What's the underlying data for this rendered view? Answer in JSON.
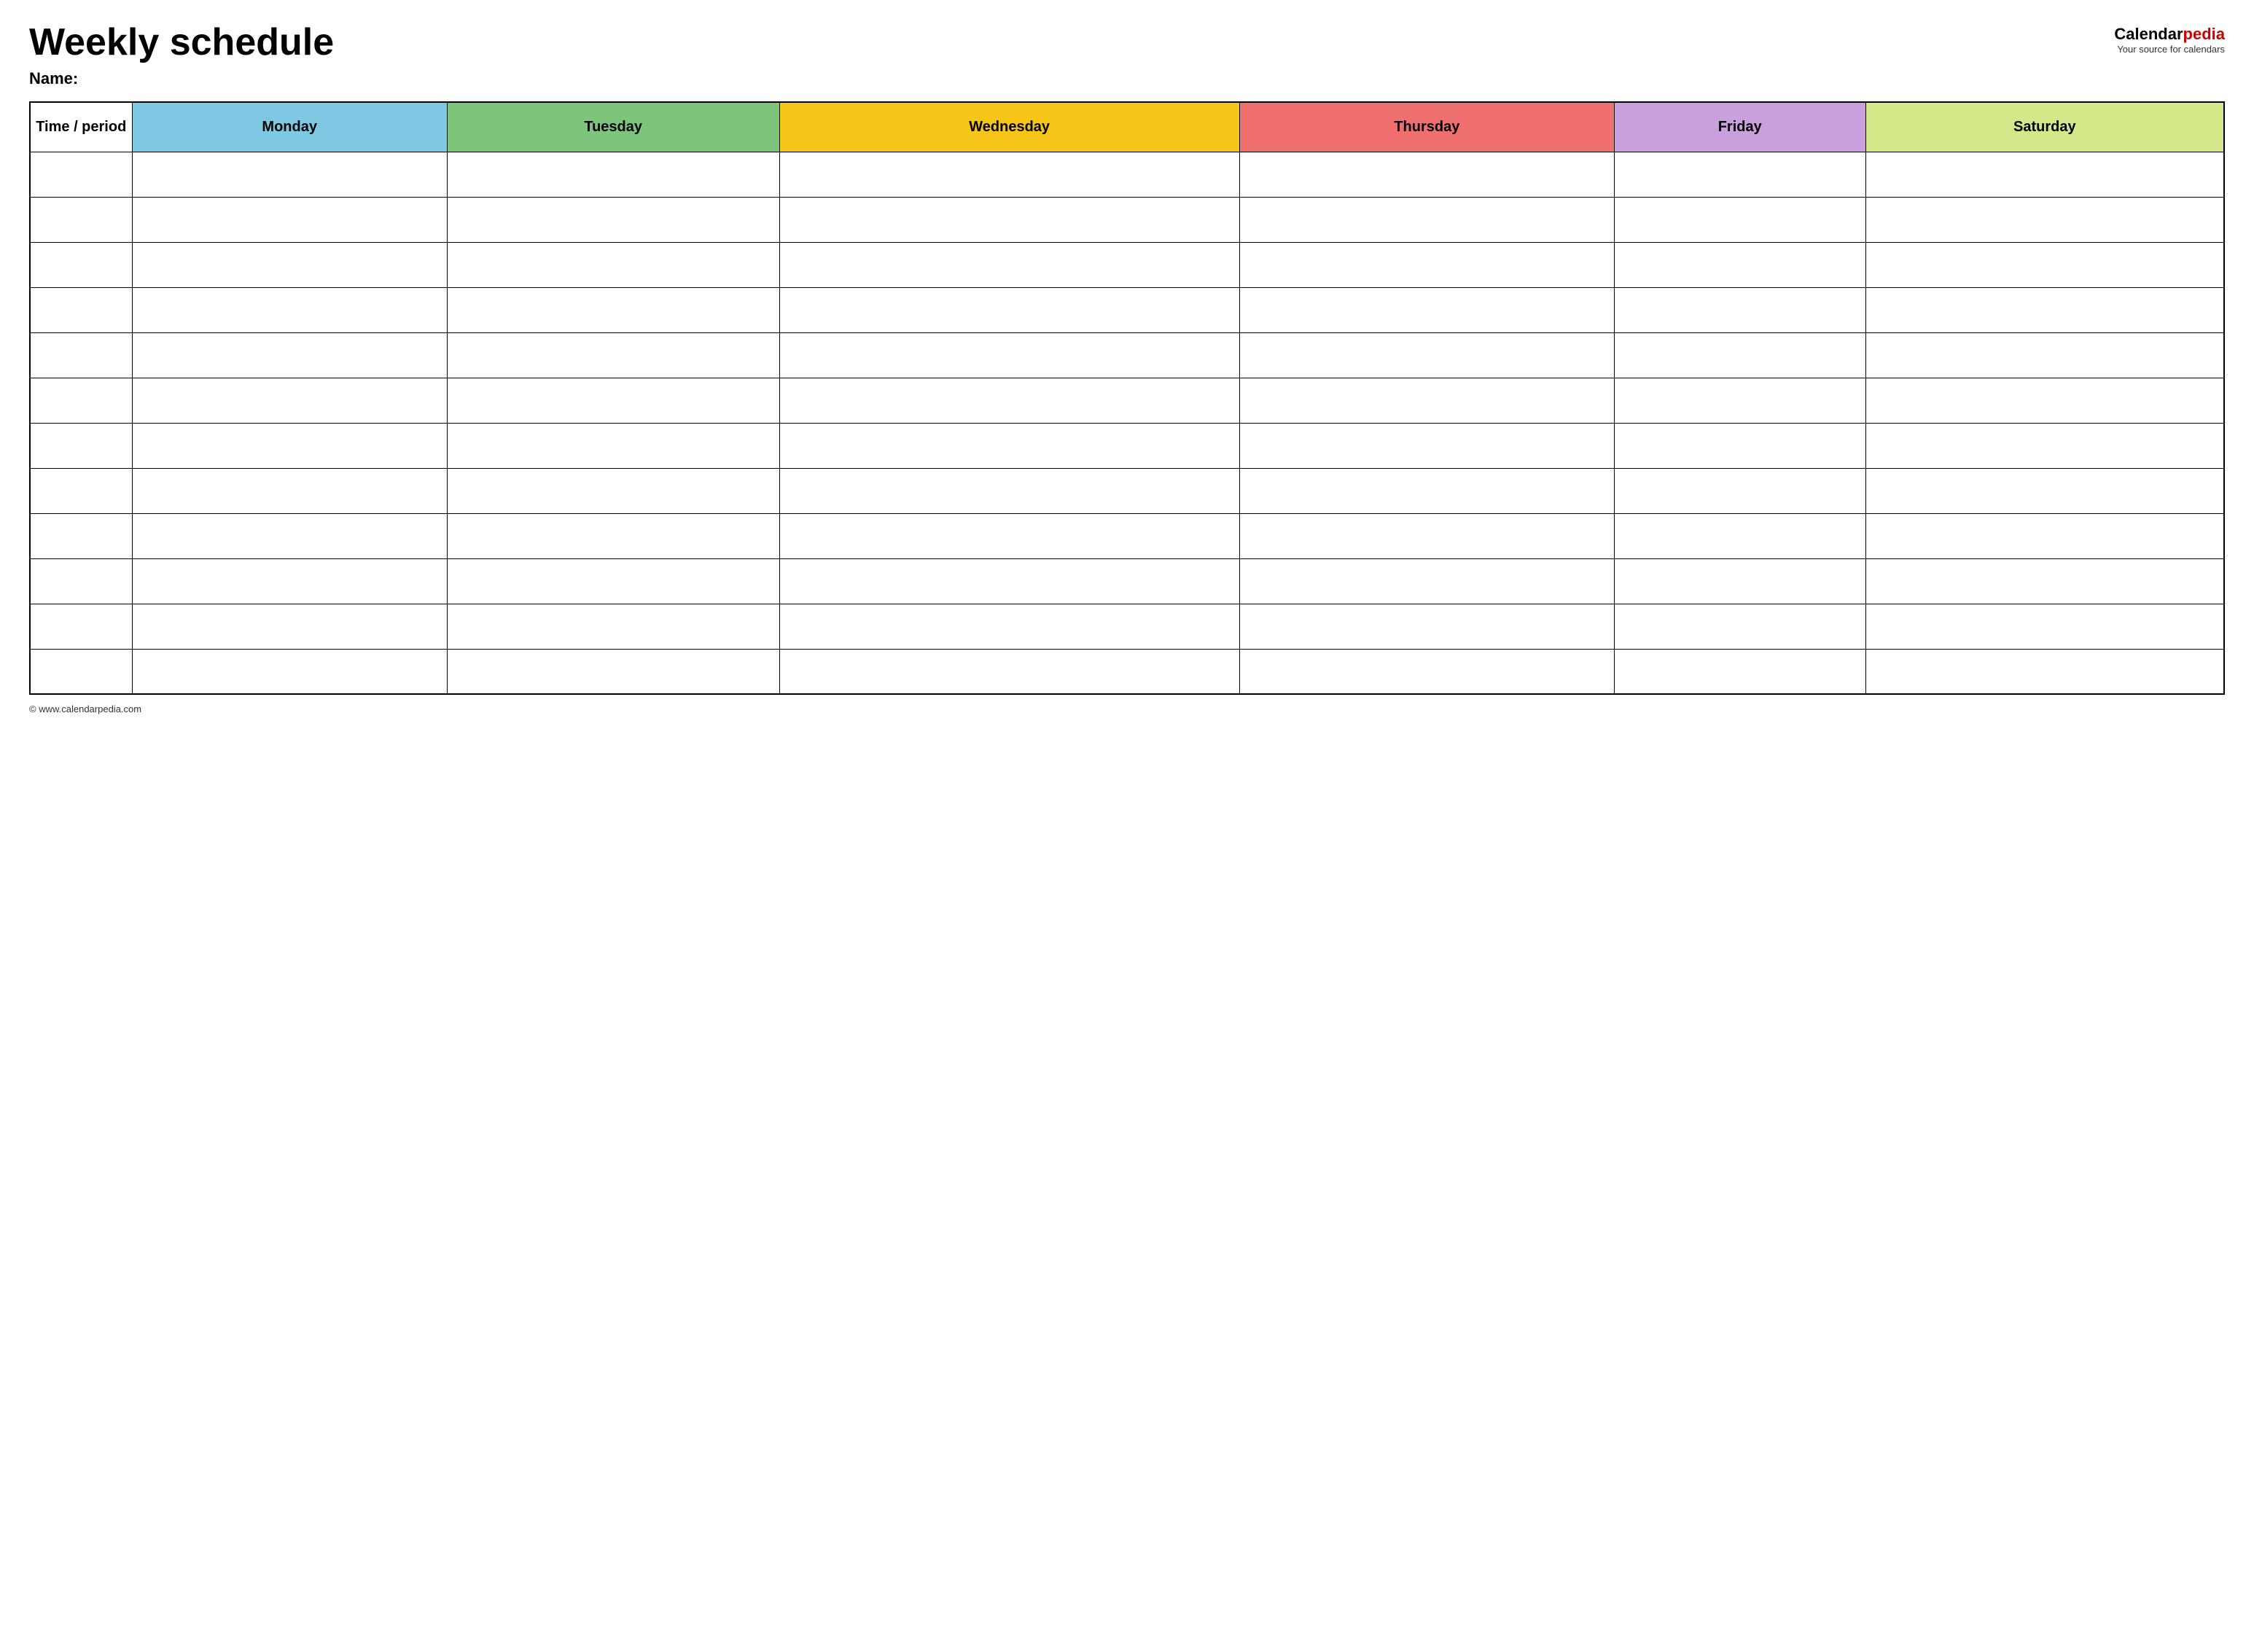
{
  "header": {
    "title": "Weekly schedule",
    "name_label": "Name:",
    "logo_part1": "Calendar",
    "logo_part2": "pedia",
    "logo_tagline": "Your source for calendars",
    "logo_url_text": "www.calendarpedia.com"
  },
  "table": {
    "columns": [
      {
        "key": "time",
        "label": "Time / period",
        "class": "th-time"
      },
      {
        "key": "monday",
        "label": "Monday",
        "class": "th-monday"
      },
      {
        "key": "tuesday",
        "label": "Tuesday",
        "class": "th-tuesday"
      },
      {
        "key": "wednesday",
        "label": "Wednesday",
        "class": "th-wednesday"
      },
      {
        "key": "thursday",
        "label": "Thursday",
        "class": "th-thursday"
      },
      {
        "key": "friday",
        "label": "Friday",
        "class": "th-friday"
      },
      {
        "key": "saturday",
        "label": "Saturday",
        "class": "th-saturday"
      }
    ],
    "rows": 12
  },
  "footer": {
    "url": "© www.calendarpedia.com"
  }
}
